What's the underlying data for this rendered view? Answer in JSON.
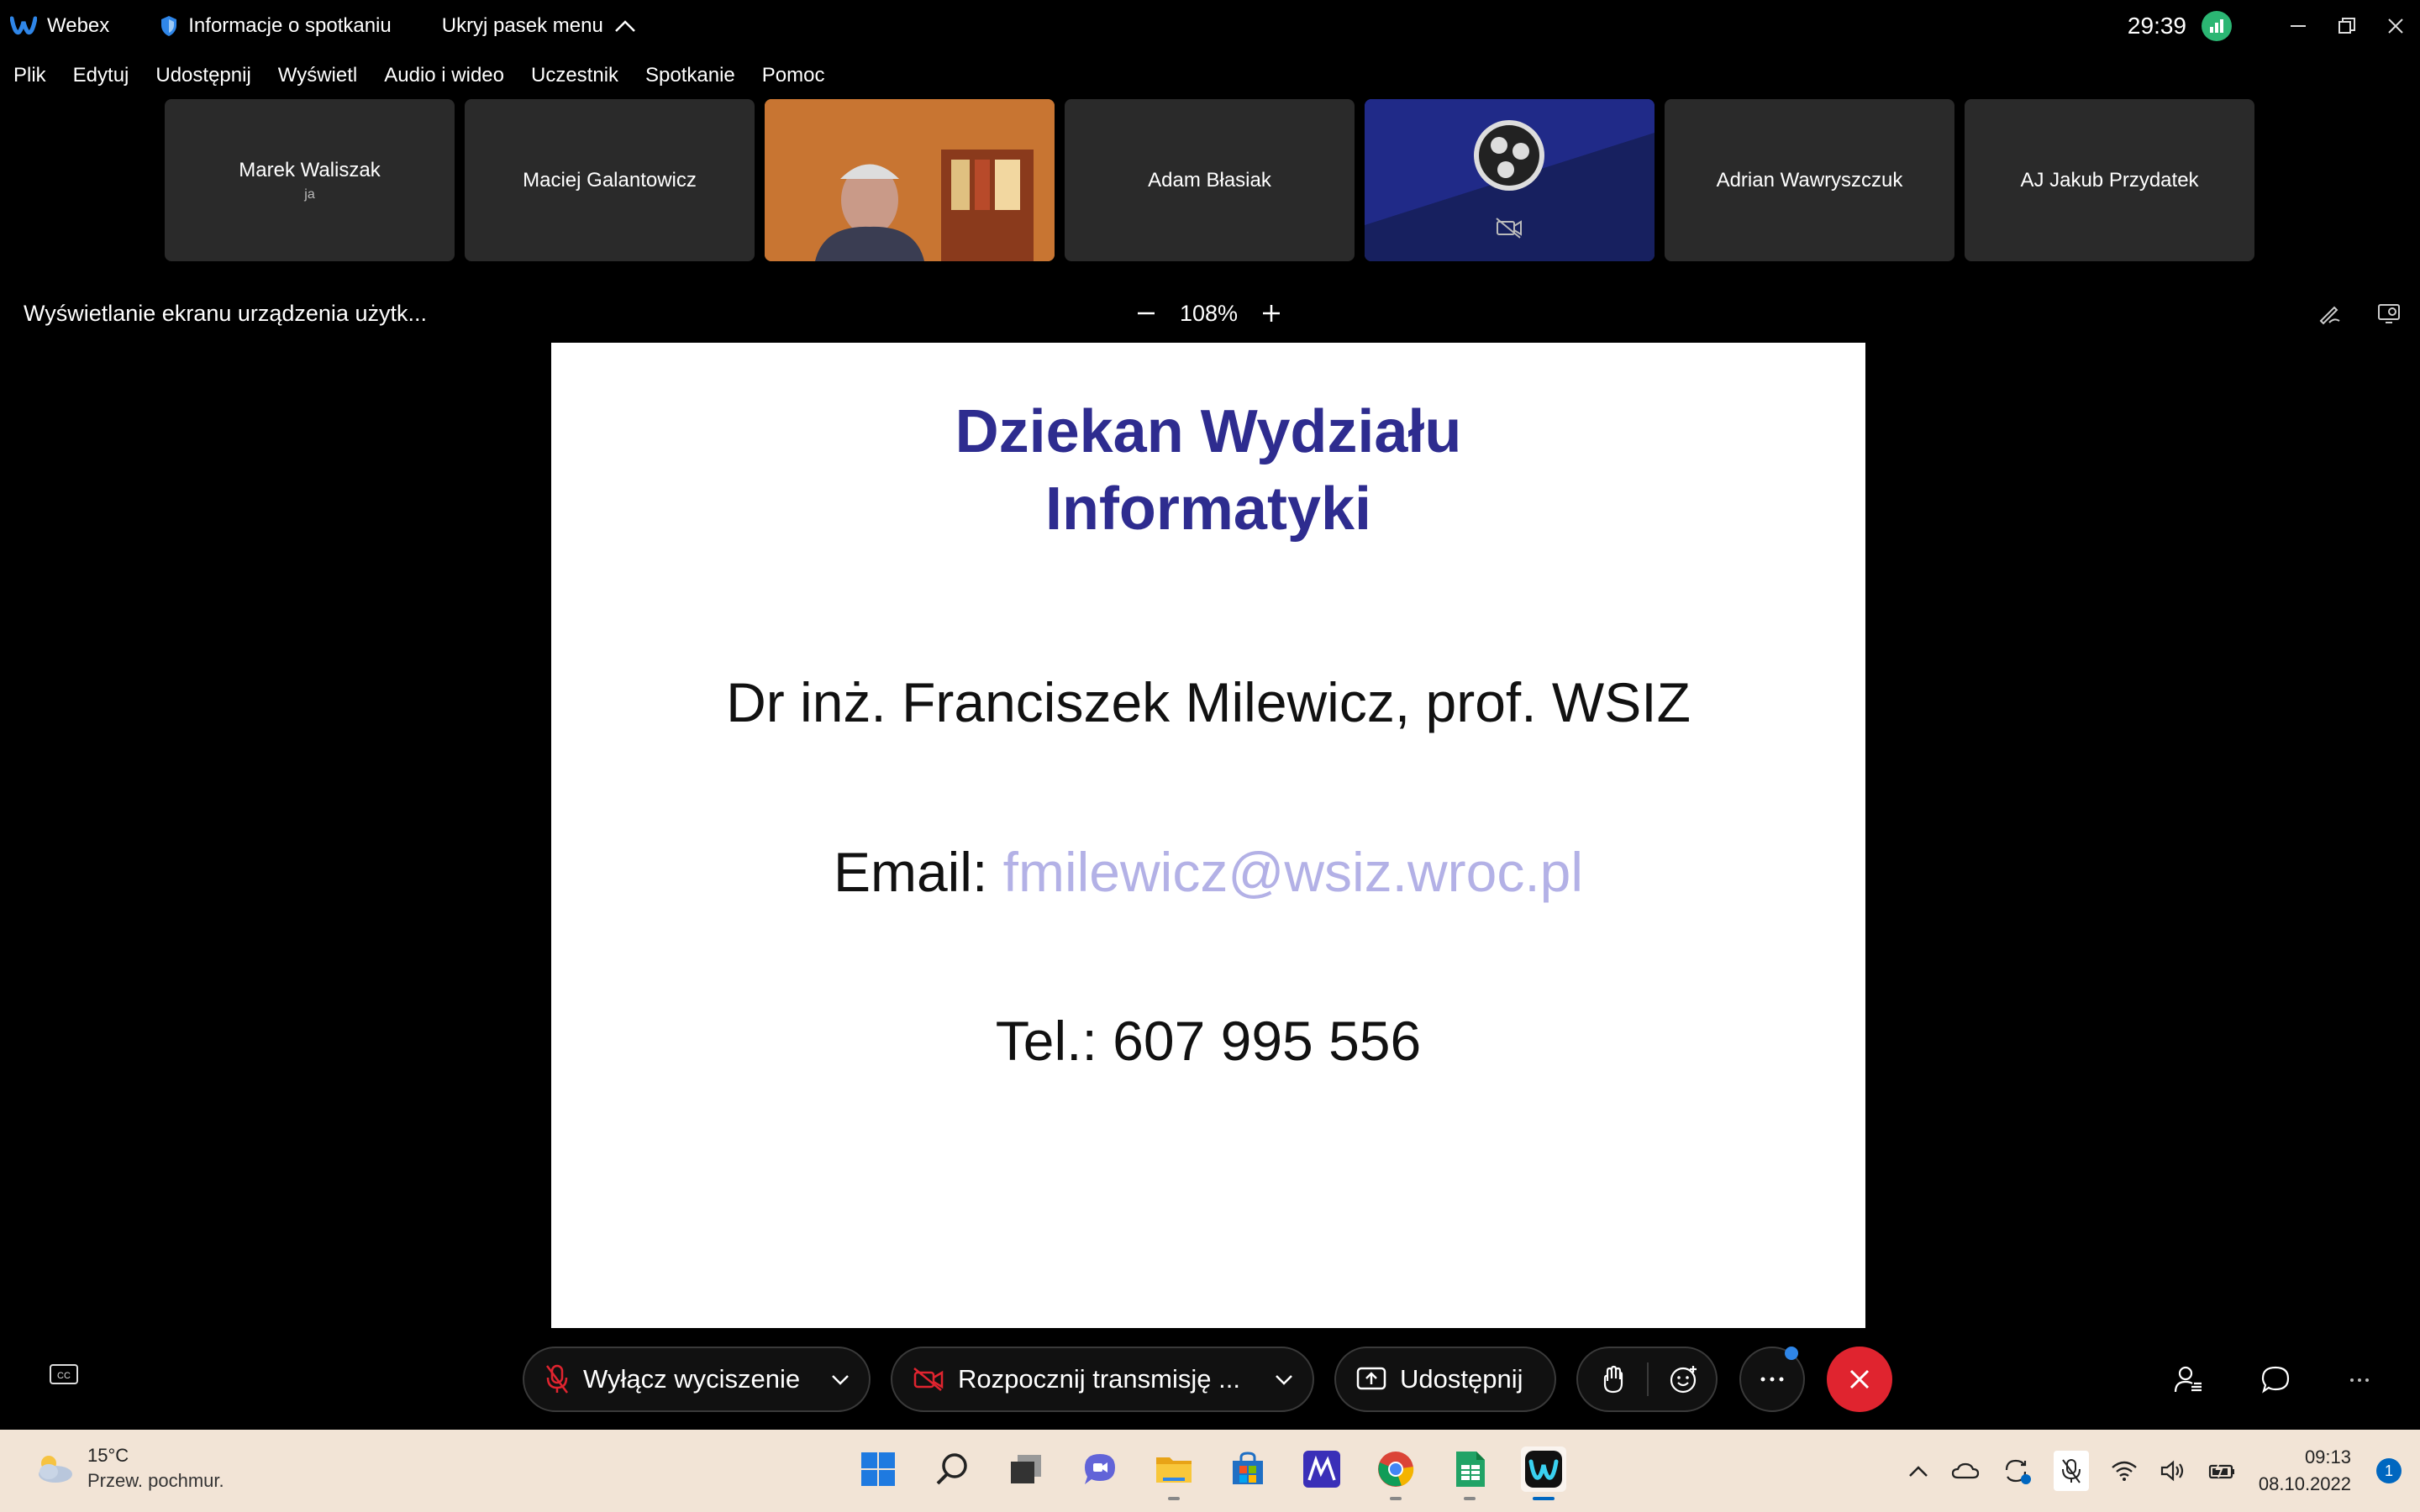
{
  "titlebar": {
    "app_name": "Webex",
    "meeting_info": "Informacje o spotkaniu",
    "hide_menu": "Ukryj pasek menu",
    "timer": "29:39"
  },
  "menu": [
    "Plik",
    "Edytuj",
    "Udostępnij",
    "Wyświetl",
    "Audio i wideo",
    "Uczestnik",
    "Spotkanie",
    "Pomoc"
  ],
  "participants": [
    {
      "name": "Marek Waliszak",
      "sub": "ja",
      "kind": "name"
    },
    {
      "name": "Maciej Galantowicz",
      "sub": "",
      "kind": "name"
    },
    {
      "name": "",
      "sub": "",
      "kind": "video"
    },
    {
      "name": "Adam Błasiak",
      "sub": "",
      "kind": "name"
    },
    {
      "name": "",
      "sub": "",
      "kind": "obs"
    },
    {
      "name": "Adrian Wawryszczuk",
      "sub": "",
      "kind": "name"
    },
    {
      "name": "AJ Jakub Przydatek",
      "sub": "",
      "kind": "name"
    }
  ],
  "share": {
    "title": "Wyświetlanie ekranu urządzenia użytk...",
    "zoom": "108%"
  },
  "slide": {
    "title_line1": "Dziekan Wydziału",
    "title_line2": "Informatyki",
    "person": "Dr inż. Franciszek Milewicz, prof. WSIZ",
    "email_label": "Email: ",
    "email": "fmilewicz@wsiz.wroc.pl",
    "phone": "Tel.: 607 995 556"
  },
  "controls": {
    "unmute": "Wyłącz wyciszenie",
    "start_video": "Rozpocznij transmisję ...",
    "share": "Udostępnij"
  },
  "taskbar": {
    "temperature": "15°C",
    "weather": "Przew. pochmur.",
    "time": "09:13",
    "date": "08.10.2022",
    "notifications": "1"
  },
  "colors": {
    "slide_title": "#2e2c8f",
    "email_link": "#b3b1e6",
    "end_call": "#e0242f",
    "network": "#2bb673"
  }
}
